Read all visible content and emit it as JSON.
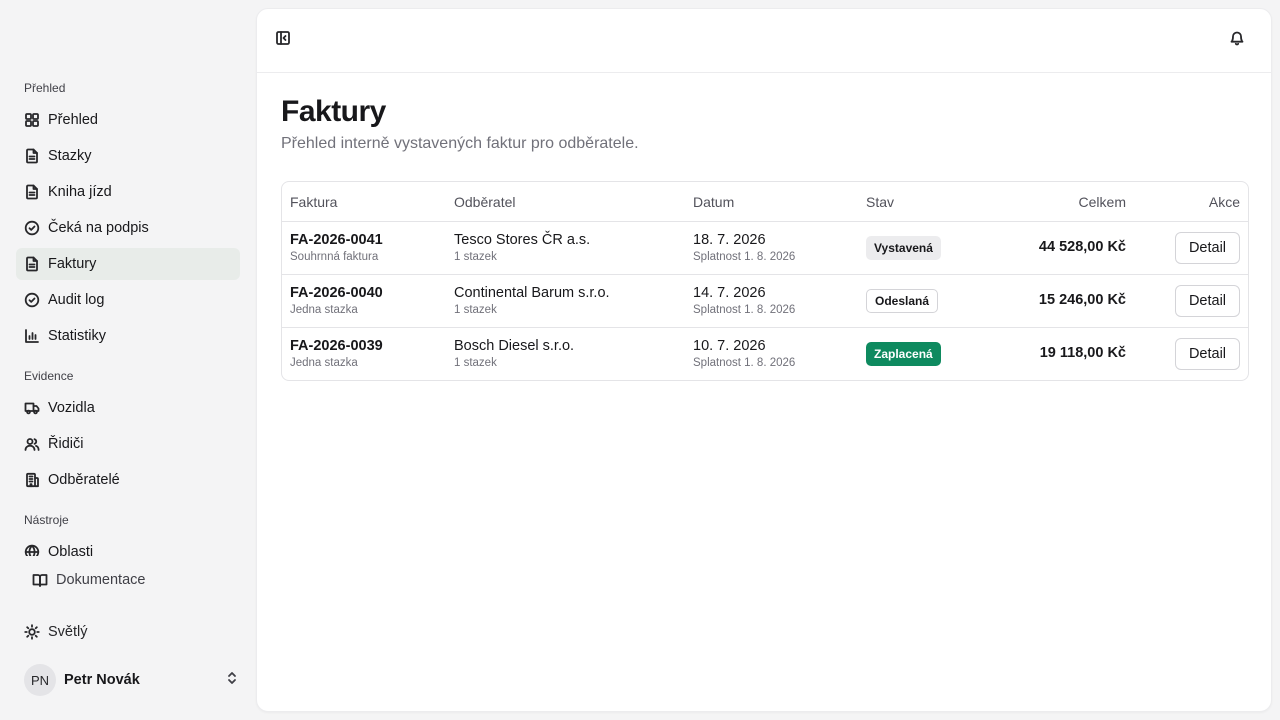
{
  "sidebar": {
    "groups": [
      {
        "label": "Přehled",
        "items": [
          {
            "label": "Přehled",
            "icon": "grid-icon"
          },
          {
            "label": "Stazky",
            "icon": "file-text-icon"
          },
          {
            "label": "Kniha jízd",
            "icon": "file-text-icon"
          },
          {
            "label": "Čeká na podpis",
            "icon": "check-circle-icon"
          },
          {
            "label": "Faktury",
            "icon": "file-text-icon",
            "active": true
          },
          {
            "label": "Audit log",
            "icon": "check-circle-icon"
          },
          {
            "label": "Statistiky",
            "icon": "bar-chart-icon"
          }
        ]
      },
      {
        "label": "Evidence",
        "items": [
          {
            "label": "Vozidla",
            "icon": "truck-icon"
          },
          {
            "label": "Řidiči",
            "icon": "users-icon"
          },
          {
            "label": "Odběratelé",
            "icon": "building-icon"
          }
        ]
      },
      {
        "label": "Nástroje",
        "items": [
          {
            "label": "Oblasti",
            "icon": "globe-icon"
          }
        ]
      }
    ],
    "docs_label": "Dokumentace",
    "theme_label": "Světlý",
    "user": {
      "initials": "PN",
      "name": "Petr Novák"
    }
  },
  "page": {
    "title": "Faktury",
    "subtitle": "Přehled interně vystavených faktur pro odběratele."
  },
  "table": {
    "headers": {
      "invoice": "Faktura",
      "customer": "Odběratel",
      "date": "Datum",
      "status": "Stav",
      "total": "Celkem",
      "actions": "Akce"
    },
    "rows": [
      {
        "number": "FA-2026-0041",
        "type": "Souhrnná faktura",
        "customer": "Tesco Stores ČR a.s.",
        "trips": "1 stazek",
        "date": "18. 7. 2026",
        "due": "Splatnost 1. 8. 2026",
        "status": "Vystavená",
        "status_kind": "issued",
        "total": "44 528,00 Kč",
        "action": "Detail"
      },
      {
        "number": "FA-2026-0040",
        "type": "Jedna stazka",
        "customer": "Continental Barum s.r.o.",
        "trips": "1 stazek",
        "date": "14. 7. 2026",
        "due": "Splatnost 1. 8. 2026",
        "status": "Odeslaná",
        "status_kind": "sent",
        "total": "15 246,00 Kč",
        "action": "Detail"
      },
      {
        "number": "FA-2026-0039",
        "type": "Jedna stazka",
        "customer": "Bosch Diesel s.r.o.",
        "trips": "1 stazek",
        "date": "10. 7. 2026",
        "due": "Splatnost 1. 8. 2026",
        "status": "Zaplacená",
        "status_kind": "paid",
        "total": "19 118,00 Kč",
        "action": "Detail"
      }
    ]
  },
  "colors": {
    "paid_badge": "#0e8a5f",
    "active_nav": "#e8ece9",
    "app_background": "#f4f4f5"
  }
}
